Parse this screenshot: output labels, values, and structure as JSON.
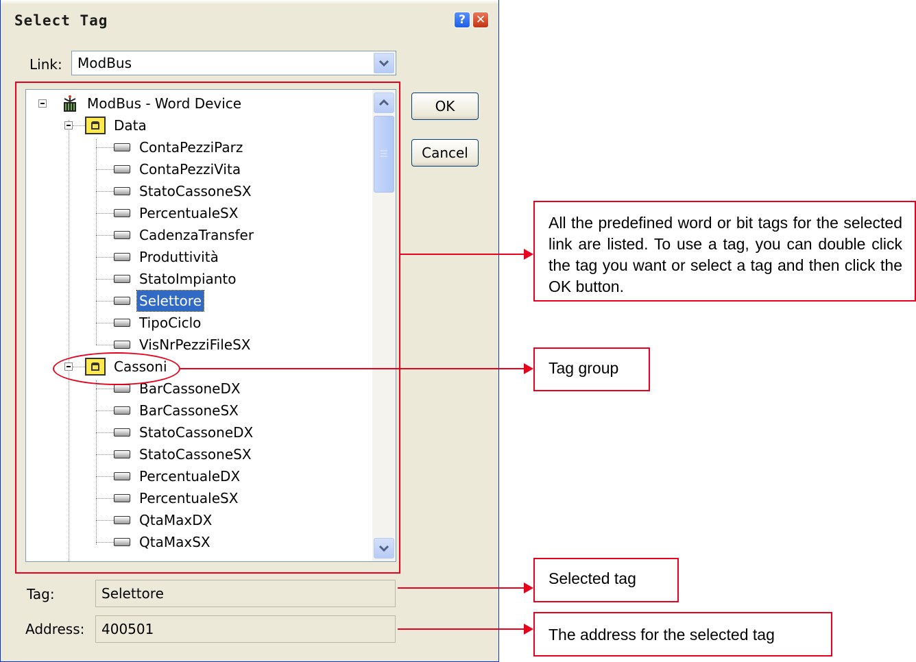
{
  "dialog": {
    "title": "Select Tag",
    "help_glyph": "?",
    "close_glyph": "✕",
    "link_label": "Link:",
    "link_value": "ModBus",
    "ok_label": "OK",
    "cancel_label": "Cancel",
    "tag_label": "Tag:",
    "tag_value": "Selettore",
    "address_label": "Address:",
    "address_value": "400501"
  },
  "tree": {
    "root": "ModBus - Word Device",
    "groups": [
      {
        "name": "Data",
        "tags": [
          "ContaPezziParz",
          "ContaPezziVita",
          "StatoCassoneSX",
          "PercentualeSX",
          "CadenzaTransfer",
          "Produttività",
          "StatoImpianto",
          "Selettore",
          "TipoCiclo",
          "VisNrPezziFileSX"
        ]
      },
      {
        "name": "Cassoni",
        "tags": [
          "BarCassoneDX",
          "BarCassoneSX",
          "StatoCassoneDX",
          "StatoCassoneSX",
          "PercentualeDX",
          "PercentualeSX",
          "QtaMaxDX",
          "QtaMaxSX"
        ]
      }
    ],
    "selected": "Selettore"
  },
  "annotations": {
    "tree_callout": "All the predefined word or bit tags for the selected link are listed. To use a tag, you can double click the tag you want or select a tag and then click the OK button.",
    "group_callout": "Tag group",
    "selected_callout": "Selected tag",
    "address_callout": "The address for the selected tag",
    "accent_color": "#e8001c"
  }
}
